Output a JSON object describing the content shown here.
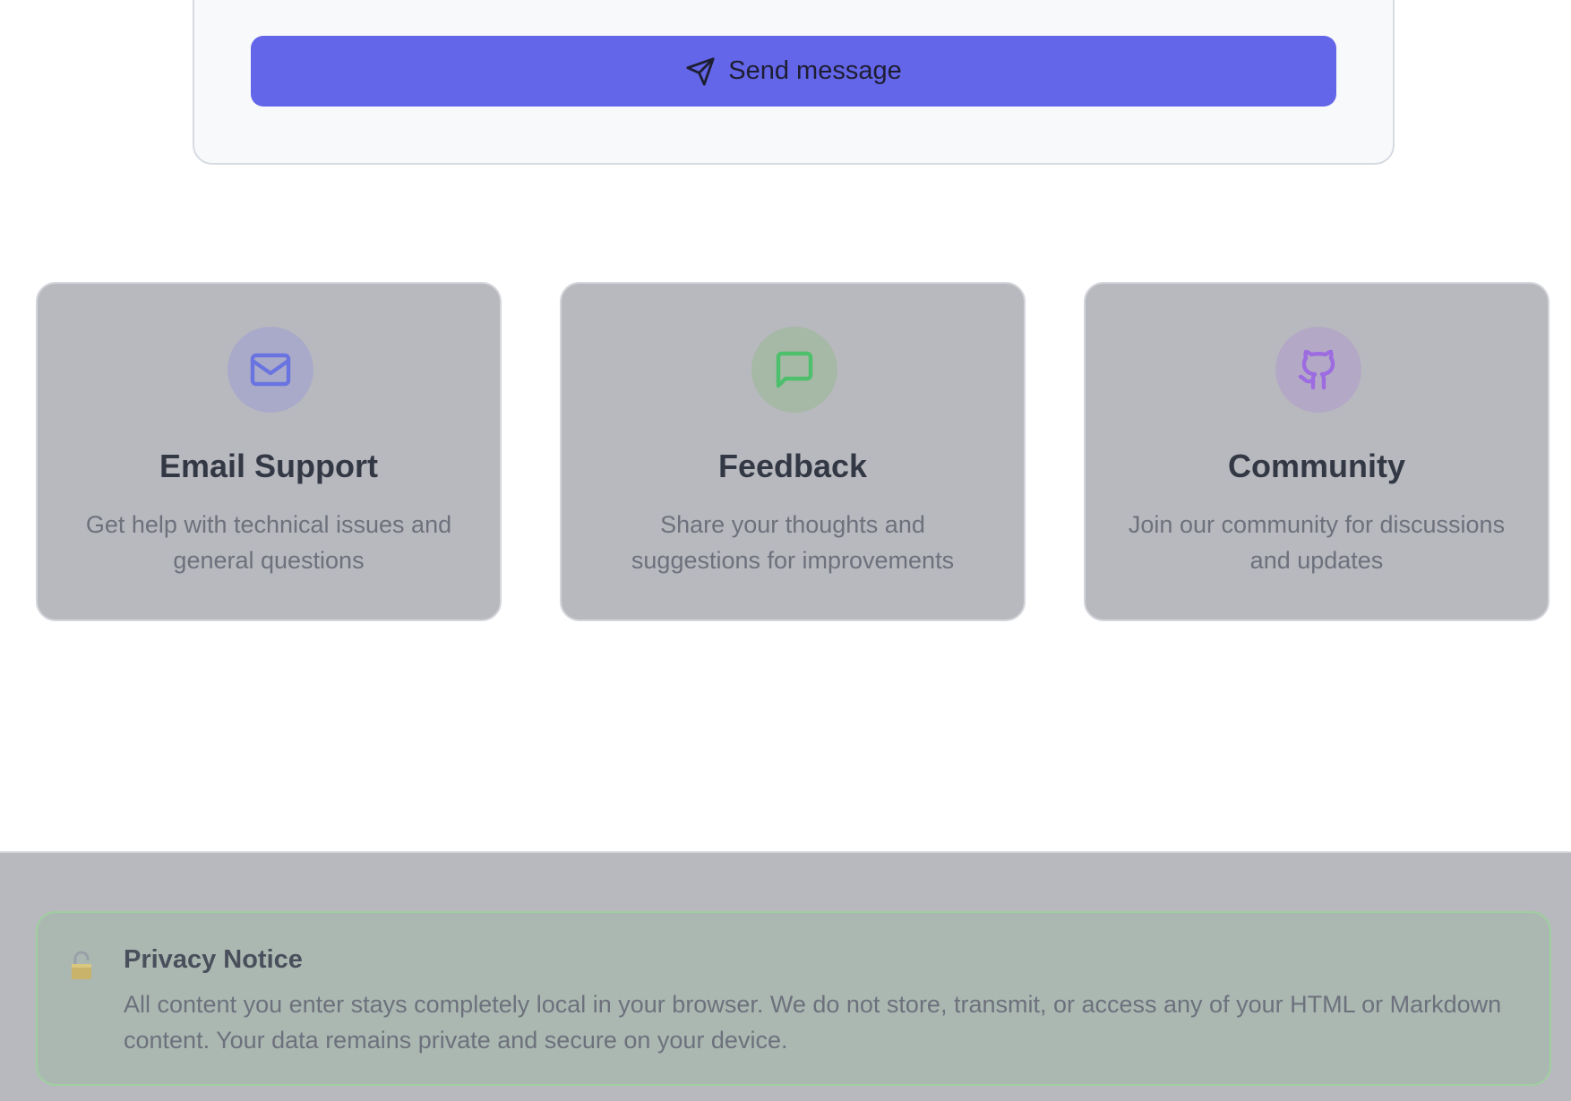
{
  "form": {
    "send_label": "Send message",
    "send_icon": "send-icon",
    "accent_color": "#6366e8"
  },
  "cards": [
    {
      "title": "Email Support",
      "description": "Get help with technical issues and general questions",
      "icon": "mail-icon",
      "icon_color": "#6a74e0",
      "icon_bg": "#a9aac9"
    },
    {
      "title": "Feedback",
      "description": "Share your thoughts and suggestions for improvements",
      "icon": "message-square-icon",
      "icon_color": "#4cc06a",
      "icon_bg": "#a6b8a6"
    },
    {
      "title": "Community",
      "description": "Join our community for discussions and updates",
      "icon": "github-icon",
      "icon_color": "#9c6ce0",
      "icon_bg": "#b3a9c6"
    }
  ],
  "privacy": {
    "icon": "lock-icon",
    "title": "Privacy Notice",
    "text": "All content you enter stays completely local in your browser. We do not store, transmit, or access any of your HTML or Markdown content. Your data remains private and secure on your device."
  }
}
